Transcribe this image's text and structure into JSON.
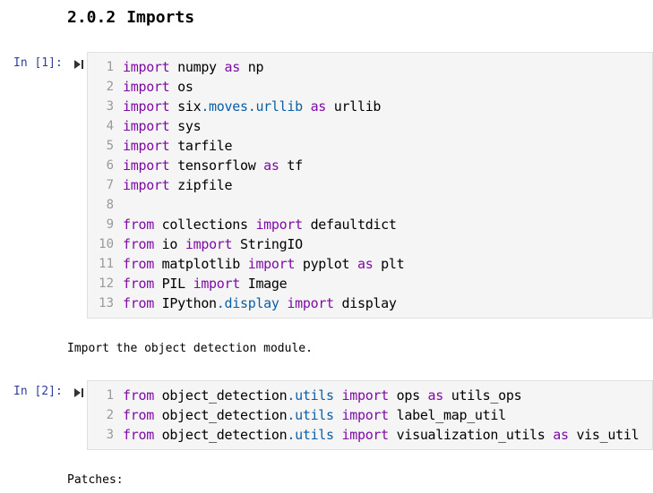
{
  "section_heading": {
    "number": "2.0.2",
    "title": "Imports"
  },
  "cells": [
    {
      "prompt": "In [1]:",
      "lines": [
        [
          {
            "t": "import",
            "c": "kw"
          },
          {
            "t": " numpy "
          },
          {
            "t": "as",
            "c": "kw"
          },
          {
            "t": " np"
          }
        ],
        [
          {
            "t": "import",
            "c": "kw"
          },
          {
            "t": " os"
          }
        ],
        [
          {
            "t": "import",
            "c": "kw"
          },
          {
            "t": " six"
          },
          {
            "t": ".moves",
            "c": "attr"
          },
          {
            "t": ".urllib",
            "c": "attr"
          },
          {
            "t": " "
          },
          {
            "t": "as",
            "c": "kw"
          },
          {
            "t": " urllib"
          }
        ],
        [
          {
            "t": "import",
            "c": "kw"
          },
          {
            "t": " sys"
          }
        ],
        [
          {
            "t": "import",
            "c": "kw"
          },
          {
            "t": " tarfile"
          }
        ],
        [
          {
            "t": "import",
            "c": "kw"
          },
          {
            "t": " tensorflow "
          },
          {
            "t": "as",
            "c": "kw"
          },
          {
            "t": " tf"
          }
        ],
        [
          {
            "t": "import",
            "c": "kw"
          },
          {
            "t": " zipfile"
          }
        ],
        [],
        [
          {
            "t": "from",
            "c": "kw"
          },
          {
            "t": " collections "
          },
          {
            "t": "import",
            "c": "kw"
          },
          {
            "t": " defaultdict"
          }
        ],
        [
          {
            "t": "from",
            "c": "kw"
          },
          {
            "t": " io "
          },
          {
            "t": "import",
            "c": "kw"
          },
          {
            "t": " StringIO"
          }
        ],
        [
          {
            "t": "from",
            "c": "kw"
          },
          {
            "t": " matplotlib "
          },
          {
            "t": "import",
            "c": "kw"
          },
          {
            "t": " pyplot "
          },
          {
            "t": "as",
            "c": "kw"
          },
          {
            "t": " plt"
          }
        ],
        [
          {
            "t": "from",
            "c": "kw"
          },
          {
            "t": " PIL "
          },
          {
            "t": "import",
            "c": "kw"
          },
          {
            "t": " Image"
          }
        ],
        [
          {
            "t": "from",
            "c": "kw"
          },
          {
            "t": " IPython"
          },
          {
            "t": ".display",
            "c": "attr"
          },
          {
            "t": " "
          },
          {
            "t": "import",
            "c": "kw"
          },
          {
            "t": " display"
          }
        ]
      ]
    },
    {
      "prompt": "In [2]:",
      "lines": [
        [
          {
            "t": "from",
            "c": "kw"
          },
          {
            "t": " object_detection"
          },
          {
            "t": ".utils",
            "c": "attr"
          },
          {
            "t": " "
          },
          {
            "t": "import",
            "c": "kw"
          },
          {
            "t": " ops "
          },
          {
            "t": "as",
            "c": "kw"
          },
          {
            "t": " utils_ops"
          }
        ],
        [
          {
            "t": "from",
            "c": "kw"
          },
          {
            "t": " object_detection"
          },
          {
            "t": ".utils",
            "c": "attr"
          },
          {
            "t": " "
          },
          {
            "t": "import",
            "c": "kw"
          },
          {
            "t": " label_map_util"
          }
        ],
        [
          {
            "t": "from",
            "c": "kw"
          },
          {
            "t": " object_detection"
          },
          {
            "t": ".utils",
            "c": "attr"
          },
          {
            "t": " "
          },
          {
            "t": "import",
            "c": "kw"
          },
          {
            "t": " visualization_utils "
          },
          {
            "t": "as",
            "c": "kw"
          },
          {
            "t": " vis_util"
          }
        ]
      ]
    }
  ],
  "markdown": {
    "import_note": "Import the object detection module.",
    "patches": "Patches:"
  },
  "icons": {
    "run": "run-cell-icon"
  },
  "colors": {
    "keyword": "#7f0ba6",
    "attribute": "#0b5fa6",
    "prompt": "#303f9f",
    "cell_bg": "#f5f5f5",
    "line_number": "#999999"
  }
}
